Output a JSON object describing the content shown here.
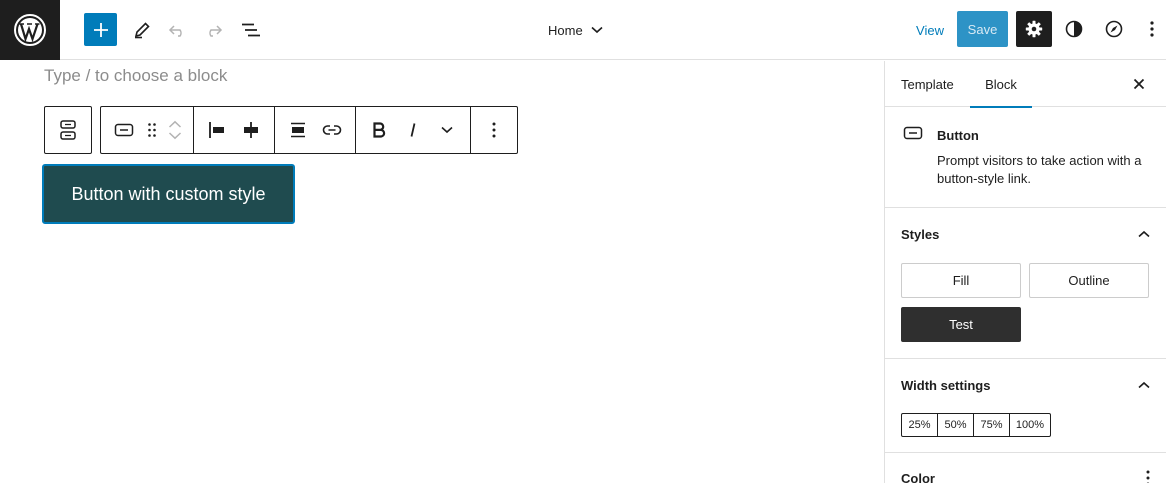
{
  "topbar": {
    "document_title": "Home",
    "view_label": "View",
    "save_label": "Save"
  },
  "canvas": {
    "placeholder": "Type / to choose a block",
    "button_text": "Button with custom style"
  },
  "sidebar": {
    "tabs": [
      {
        "label": "Template",
        "active": false
      },
      {
        "label": "Block",
        "active": true
      }
    ],
    "block": {
      "title": "Button",
      "description": "Prompt visitors to take action with a button-style link."
    },
    "styles": {
      "title": "Styles",
      "options": [
        {
          "label": "Fill",
          "selected": false
        },
        {
          "label": "Outline",
          "selected": false
        },
        {
          "label": "Test",
          "selected": true
        }
      ]
    },
    "width": {
      "title": "Width settings",
      "options": [
        "25%",
        "50%",
        "75%",
        "100%"
      ]
    },
    "color": {
      "title": "Color"
    }
  },
  "colors": {
    "accent": "#007cba",
    "dark": "#1e1e1e",
    "button_bg": "#1f4b4f",
    "selected_style": "#2f2f2f"
  },
  "icons": [
    "wordpress-logo-icon",
    "plus-icon",
    "pencil-icon",
    "undo-icon",
    "redo-icon",
    "list-view-icon",
    "chevron-down-icon",
    "gear-icon",
    "half-circle-icon",
    "compass-icon",
    "more-vertical-icon",
    "close-icon",
    "button-icon",
    "drag-handle-icon",
    "align-left-icon",
    "justify-center-icon",
    "align-wide-icon",
    "link-icon",
    "bold-icon",
    "italic-icon"
  ]
}
